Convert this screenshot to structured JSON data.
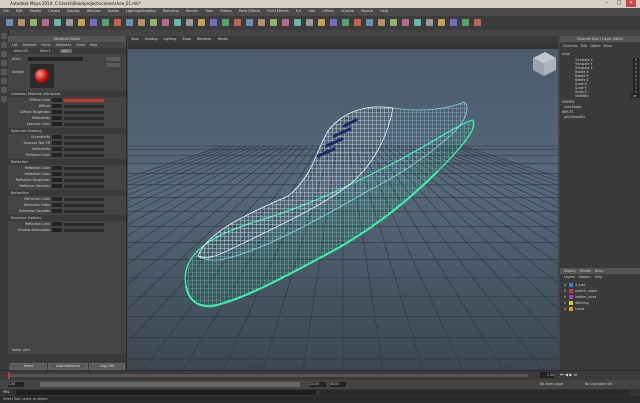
{
  "window": {
    "title": "Autodesk Maya 2014: C:\\Users\\Shoe\\project\\scenes\\shoe_01.mb*",
    "controls": [
      "–",
      "□",
      "✕"
    ]
  },
  "menubar": {
    "items": [
      "File",
      "Edit",
      "Modify",
      "Create",
      "Display",
      "Window",
      "Assets",
      "Lighting/Shading",
      "Texturing",
      "Render",
      "Toon",
      "Stereo",
      "Paint Effects",
      "Fluid Effects",
      "Fur",
      "Hair",
      "nMesh",
      "nCache",
      "Muscle",
      "Help"
    ]
  },
  "attribute_editor": {
    "header": "Attribute Editor",
    "tabs": [
      "List",
      "Selected",
      "Focus",
      "Attributes",
      "Show",
      "Help"
    ],
    "node_tabs": [
      "blinn1SG",
      "blinn1",
      "pbr1"
    ],
    "sample_label": "Sample",
    "type_label": "blinn:",
    "sections": [
      {
        "title": "Common Material Attributes",
        "rows": [
          "Diffuse Color",
          "Diffuse",
          "Diffuse Roughness",
          "Reflectivity",
          "Specular Color"
        ]
      },
      {
        "title": "Specular Shading",
        "rows": [
          "Eccentricity",
          "Specular Roll Off",
          "Reflectivity",
          "Reflected Color"
        ]
      },
      {
        "title": "Reflection",
        "rows": [
          "Reflection Color",
          "Reflection Gloss",
          "Reflection Roughness",
          "Reflection Samples"
        ]
      },
      {
        "title": "Refraction",
        "rows": [
          "Refraction Color",
          "Refraction Index",
          "Refraction Samples"
        ]
      },
      {
        "title": "Raytrace Options",
        "rows": [
          "Reflection Limit",
          "Shadow Attenuation"
        ]
      }
    ],
    "footer_buttons": [
      "Select",
      "Load Attributes",
      "Copy Tab"
    ],
    "notes_label": "Notes: pbr1"
  },
  "viewport": {
    "menu": [
      "View",
      "Shading",
      "Lighting",
      "Show",
      "Renderer",
      "Panels"
    ],
    "camera_label": "persp"
  },
  "channel_box": {
    "header": "Channel Box / Layer Editor",
    "menu": [
      "Channels",
      "Edit",
      "Object",
      "Show"
    ],
    "object": "shoe",
    "channels": [
      {
        "name": "Translate X",
        "value": "0"
      },
      {
        "name": "Translate Y",
        "value": "0"
      },
      {
        "name": "Translate Z",
        "value": "0"
      },
      {
        "name": "Rotate X",
        "value": "0"
      },
      {
        "name": "Rotate Y",
        "value": "0"
      },
      {
        "name": "Rotate Z",
        "value": "0"
      },
      {
        "name": "Scale X",
        "value": "1"
      },
      {
        "name": "Scale Y",
        "value": "1"
      },
      {
        "name": "Scale Z",
        "value": "1"
      },
      {
        "name": "Visibility",
        "value": "on"
      }
    ],
    "shapes_label": "SHAPES",
    "shape_name": "shoeShape",
    "inputs_label": "INPUTS",
    "input_name": "polySmooth1"
  },
  "layers": {
    "tabs": [
      "Display",
      "Render",
      "Anim"
    ],
    "menu": [
      "Layers",
      "Options",
      "Help"
    ],
    "items": [
      {
        "name": "lt_sole",
        "color": "#3a7ad8"
      },
      {
        "name": "leather_upper",
        "color": "#c83c3c"
      },
      {
        "name": "leather_laces",
        "color": "#a83ac8"
      },
      {
        "name": "Stitching",
        "color": "#d8c83a"
      },
      {
        "name": "Laces",
        "color": "#e0a020"
      }
    ]
  },
  "timeline": {
    "start": "1.00",
    "end": "24.00",
    "current": "1.00",
    "range_end": "48.00",
    "anim_layer": "No Anim Layer",
    "char_set": "No Character Set"
  },
  "commandline": {
    "label": "MEL"
  },
  "helpline": {
    "text": "Select Tool: select an object"
  },
  "colors": {
    "accent": "#55aaff",
    "wire_upper_white": "#e8eef5",
    "wire_upper_cyan": "#8ae0f0",
    "wire_sole_green": "#3cf0a8",
    "laces": "#1a2a6a"
  }
}
